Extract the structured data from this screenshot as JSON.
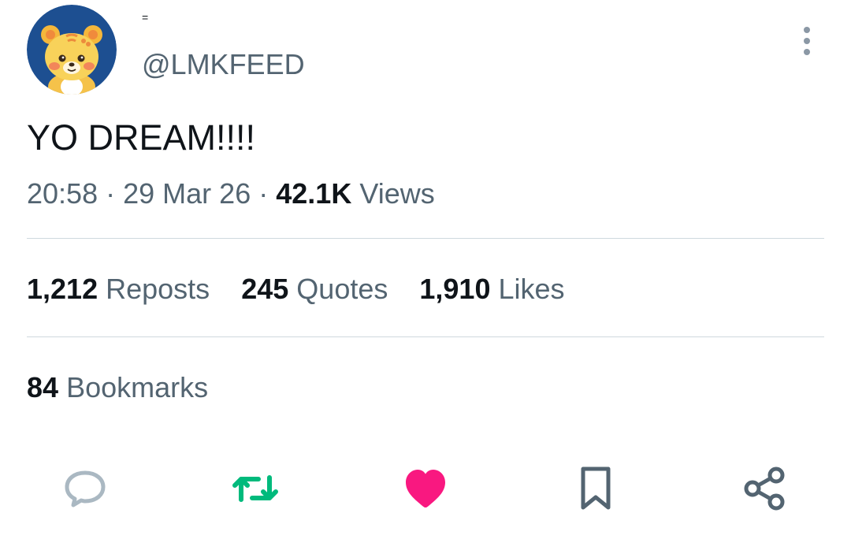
{
  "author": {
    "display_name": "=",
    "handle": "@LMKFEED",
    "avatar_icon": "cartoon-tiger-avatar"
  },
  "tweet": {
    "text": "YO DREAM!!!!",
    "time": "20:58",
    "separator": "·",
    "date": "29 Mar 26",
    "views_count": "42.1K",
    "views_label": "Views"
  },
  "stats": {
    "reposts_count": "1,212",
    "reposts_label": "Reposts",
    "quotes_count": "245",
    "quotes_label": "Quotes",
    "likes_count": "1,910",
    "likes_label": "Likes",
    "bookmarks_count": "84",
    "bookmarks_label": "Bookmarks"
  },
  "actions": [
    {
      "icon": "reply-icon",
      "color": "#aab8c2"
    },
    {
      "icon": "repost-icon",
      "color": "#00ba7c"
    },
    {
      "icon": "like-icon",
      "color": "#f91880"
    },
    {
      "icon": "bookmark-icon",
      "color": "#536471"
    },
    {
      "icon": "share-icon",
      "color": "#536471"
    }
  ],
  "colors": {
    "text_primary": "#0f1419",
    "text_secondary": "#536471",
    "divider": "#cfd9de",
    "repost_green": "#00ba7c",
    "like_pink": "#f91880",
    "avatar_bg": "#1d4f91"
  }
}
